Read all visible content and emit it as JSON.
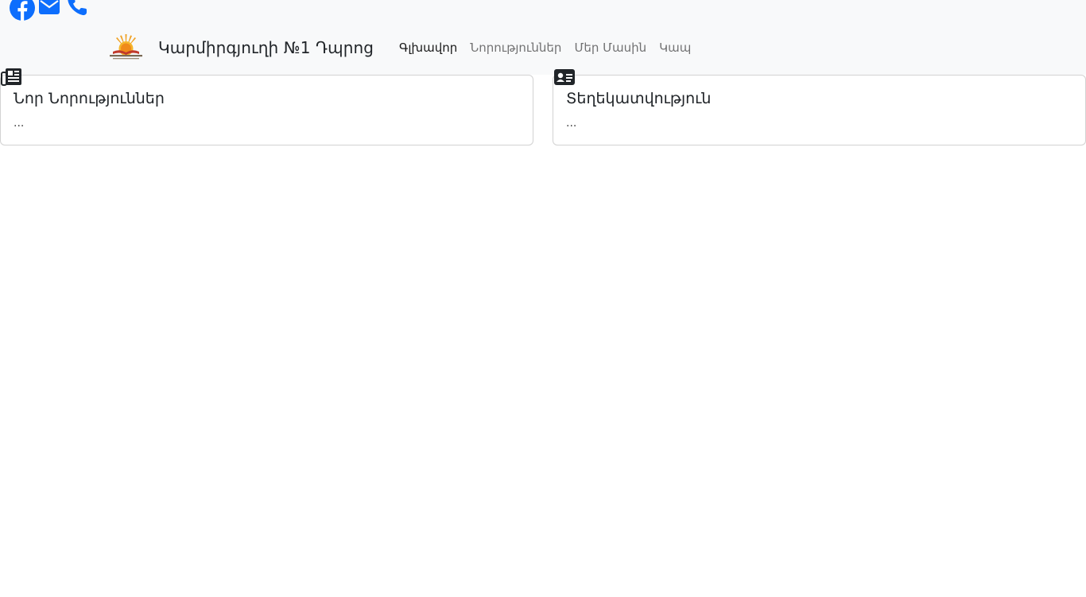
{
  "social": {
    "icons": [
      "facebook-icon",
      "envelope-icon",
      "phone-icon"
    ],
    "color": "#0d6efd"
  },
  "navbar": {
    "brand_name": "Կարմիրգյուղի №1 Դպրոց",
    "links": [
      {
        "label": "Գլխավոր",
        "active": true
      },
      {
        "label": "Նորություններ",
        "active": false
      },
      {
        "label": "Մեր Մասին",
        "active": false
      },
      {
        "label": "Կապ",
        "active": false
      }
    ]
  },
  "cards": [
    {
      "icon": "newspaper-icon",
      "title": "Նոր Նորություններ",
      "text": "..."
    },
    {
      "icon": "id-card-icon",
      "title": "Տեղեկատվություն",
      "text": "..."
    }
  ]
}
